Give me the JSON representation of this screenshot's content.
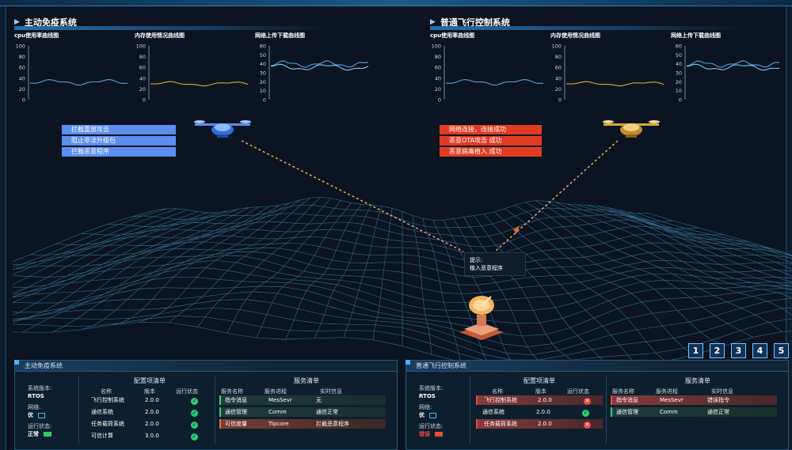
{
  "left_system": {
    "title": "主动免疫系统",
    "charts": {
      "cpu": {
        "title": "cpu使用率曲线图",
        "yticks": [
          "100",
          "80",
          "60",
          "40",
          "20",
          "0"
        ]
      },
      "mem": {
        "title": "内存使用情况曲线图",
        "yticks": [
          "100",
          "80",
          "60",
          "40",
          "20",
          "0"
        ]
      },
      "net": {
        "title": "网络上传下载曲线图",
        "yticks": [
          "60",
          "50",
          "40",
          "30",
          "20",
          "10",
          "0"
        ]
      }
    },
    "labels": [
      "拦截重放攻击",
      "阻止非法升级包",
      "拦截恶意程序"
    ]
  },
  "right_system": {
    "title": "普通飞行控制系统",
    "charts": {
      "cpu": {
        "title": "cpu使用率曲线图",
        "yticks": [
          "100",
          "80",
          "60",
          "40",
          "20",
          "0"
        ]
      },
      "mem": {
        "title": "内存使用情况曲线图",
        "yticks": [
          "100",
          "80",
          "60",
          "40",
          "20",
          "0"
        ]
      },
      "net": {
        "title": "网络上传下载曲线图",
        "yticks": [
          "60",
          "50",
          "40",
          "30",
          "20",
          "10",
          "0"
        ]
      }
    },
    "labels": [
      "网络连接，连接成功",
      "恶意OTA攻击 成功",
      "恶意病毒植入 成功"
    ]
  },
  "tooltip": {
    "title": "提示:",
    "text": "植入恶意程序"
  },
  "pages": [
    "1",
    "2",
    "3",
    "4",
    "5"
  ],
  "left_panel": {
    "title": "主动免疫系统",
    "status": {
      "version_label": "系统版本:",
      "version_value": "RTOS",
      "network_label": "网络:",
      "network_value": "优",
      "run_label": "运行状态:",
      "run_value": "正常"
    },
    "config": {
      "title": "配置项清单",
      "headers": [
        "名称",
        "版本",
        "运行状态"
      ],
      "rows": [
        {
          "name": "飞行控制系统",
          "version": "2.0.0",
          "ok": true
        },
        {
          "name": "通信系统",
          "version": "2.0.0",
          "ok": true
        },
        {
          "name": "任务载荷系统",
          "version": "2.0.0",
          "ok": true
        },
        {
          "name": "可信计算",
          "version": "3.0.0",
          "ok": true
        }
      ]
    },
    "services": {
      "title": "服务清单",
      "headers": [
        "服务名称",
        "服务进程",
        "实时信息"
      ],
      "rows": [
        {
          "name": "指令消息",
          "process": "MesSevr",
          "info": "无"
        },
        {
          "name": "通信管理",
          "process": "Comm",
          "info": "通信正常"
        },
        {
          "name": "可信度量",
          "process": "Tipcore",
          "info": "拦截恶意程序"
        }
      ]
    }
  },
  "right_panel": {
    "title": "普通飞行控制系统",
    "status": {
      "version_label": "系统版本:",
      "version_value": "RTOS",
      "network_label": "网络:",
      "network_value": "优",
      "run_label": "运行状态:",
      "run_value": "错误"
    },
    "config": {
      "title": "配置项清单",
      "headers": [
        "名称",
        "版本",
        "运行状态"
      ],
      "rows": [
        {
          "name": "飞行控制系统",
          "version": "2.0.0",
          "ok": false
        },
        {
          "name": "通信系统",
          "version": "2.0.0",
          "ok": true
        },
        {
          "name": "任务载荷系统",
          "version": "2.0.0",
          "ok": false
        }
      ]
    },
    "services": {
      "title": "服务清单",
      "headers": [
        "服务名称",
        "服务进程",
        "实时信息"
      ],
      "rows": [
        {
          "name": "指令消息",
          "process": "MesSevr",
          "info": "错误指令"
        },
        {
          "name": "通信管理",
          "process": "Comm",
          "info": "通信正常"
        }
      ]
    }
  },
  "colors": {
    "cpu_line": "#4fa3e8",
    "mem_line": "#d8a93a",
    "net_line": "#4fa3e8",
    "accent": "#4ab0ff",
    "ok": "#2ecc71",
    "error": "#e74c3c"
  }
}
